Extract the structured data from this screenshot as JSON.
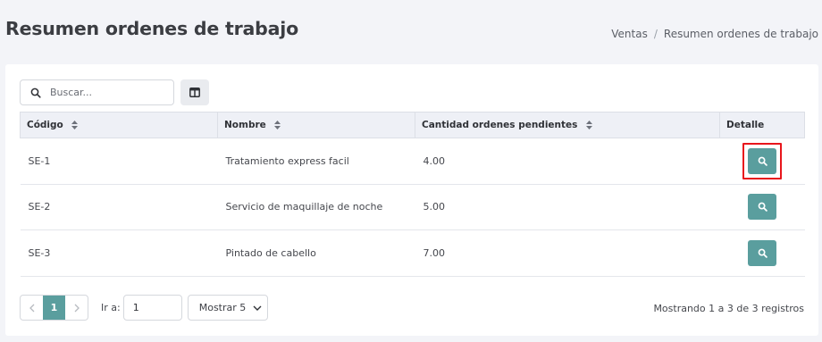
{
  "header": {
    "title": "Resumen ordenes de trabajo",
    "breadcrumb": [
      "Ventas",
      "Resumen ordenes de trabajo"
    ],
    "breadcrumb_separator": "/"
  },
  "toolbar": {
    "search_placeholder": "Buscar...",
    "search_value": ""
  },
  "table": {
    "columns": [
      "Código",
      "Nombre",
      "Cantidad ordenes pendientes",
      "Detalle"
    ],
    "rows": [
      {
        "codigo": "SE-1",
        "nombre": "Tratamiento express facil",
        "cantidad": "4.00",
        "highlighted": true
      },
      {
        "codigo": "SE-2",
        "nombre": "Servicio de maquillaje de noche",
        "cantidad": "5.00",
        "highlighted": false
      },
      {
        "codigo": "SE-3",
        "nombre": "Pintado de cabello",
        "cantidad": "7.00",
        "highlighted": false
      }
    ]
  },
  "pagination": {
    "current_page": "1",
    "goto_label": "Ir a:",
    "goto_value": "1",
    "page_size_label": "Mostrar 5",
    "summary": "Mostrando 1 a 3 de 3 registros"
  },
  "colors": {
    "accent": "#5a9e9e",
    "highlight": "#e8161c",
    "header_bg": "#eef0f6"
  },
  "icons": {
    "search": "search-icon",
    "columns": "columns-icon",
    "sort": "sort-icon",
    "prev": "chevron-left-icon",
    "next": "chevron-right-icon",
    "dropdown": "chevron-down-icon"
  }
}
